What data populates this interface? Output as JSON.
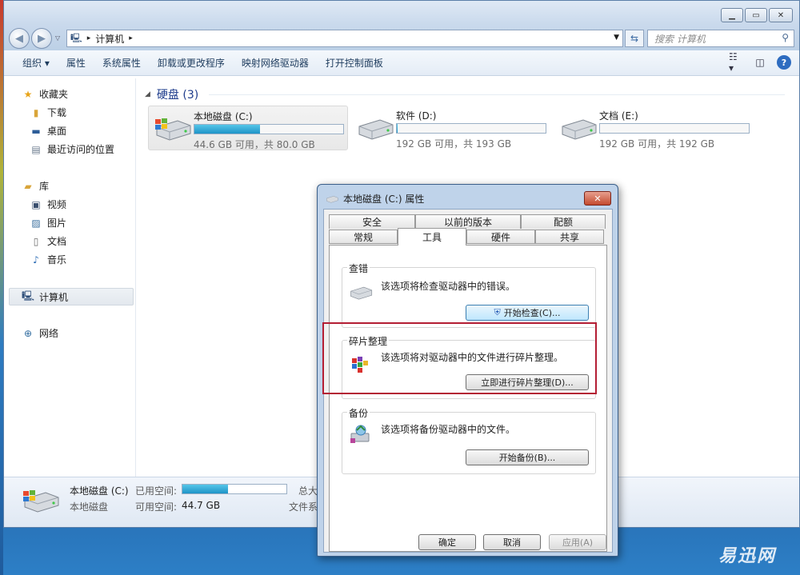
{
  "window": {
    "buttons": {
      "minimize": "▭",
      "maximize": "▭",
      "close": "✕"
    }
  },
  "address": {
    "path": "计算机",
    "search_placeholder": "搜索 计算机"
  },
  "toolbar": {
    "items": [
      "组织 ▾",
      "属性",
      "系统属性",
      "卸载或更改程序",
      "映射网络驱动器",
      "打开控制面板"
    ]
  },
  "sidebar": {
    "favorites": "收藏夹",
    "favorites_items": [
      "下载",
      "桌面",
      "最近访问的位置"
    ],
    "libraries": "库",
    "library_items": [
      "视频",
      "图片",
      "文档",
      "音乐"
    ],
    "computer": "计算机",
    "network": "网络"
  },
  "content": {
    "group_header": "硬盘 (3)",
    "drives": [
      {
        "name": "本地磁盘 (C:)",
        "space": "44.6 GB 可用，共 80.0 GB",
        "used_fraction": 0.44
      },
      {
        "name": "软件 (D:)",
        "space": "192 GB 可用，共 193 GB",
        "used_fraction": 0.005
      },
      {
        "name": "文档 (E:)",
        "space": "192 GB 可用，共 192 GB",
        "used_fraction": 0.0
      }
    ]
  },
  "details": {
    "name": "本地磁盘 (C:)",
    "type": "本地磁盘",
    "used_label": "已用空间:",
    "free_label": "可用空间:",
    "free_value": "44.7 GB",
    "used_fraction": 0.44,
    "total_label_partial": "总大",
    "fs_label_partial": "文件系"
  },
  "dialog": {
    "title": "本地磁盘 (C:) 属性",
    "close": "✕",
    "tabs_row1": [
      "安全",
      "以前的版本",
      "配额"
    ],
    "tabs_row2": [
      "常规",
      "工具",
      "硬件",
      "共享"
    ],
    "active_tab": "工具",
    "error_check": {
      "title": "查错",
      "text": "该选项将检查驱动器中的错误。",
      "button": "开始检查(C)..."
    },
    "defrag": {
      "title": "碎片整理",
      "text": "该选项将对驱动器中的文件进行碎片整理。",
      "button": "立即进行碎片整理(D)..."
    },
    "backup": {
      "title": "备份",
      "text": "该选项将备份驱动器中的文件。",
      "button": "开始备份(B)..."
    },
    "ok": "确定",
    "cancel": "取消",
    "apply": "应用(A)"
  },
  "watermark": "易迅网"
}
